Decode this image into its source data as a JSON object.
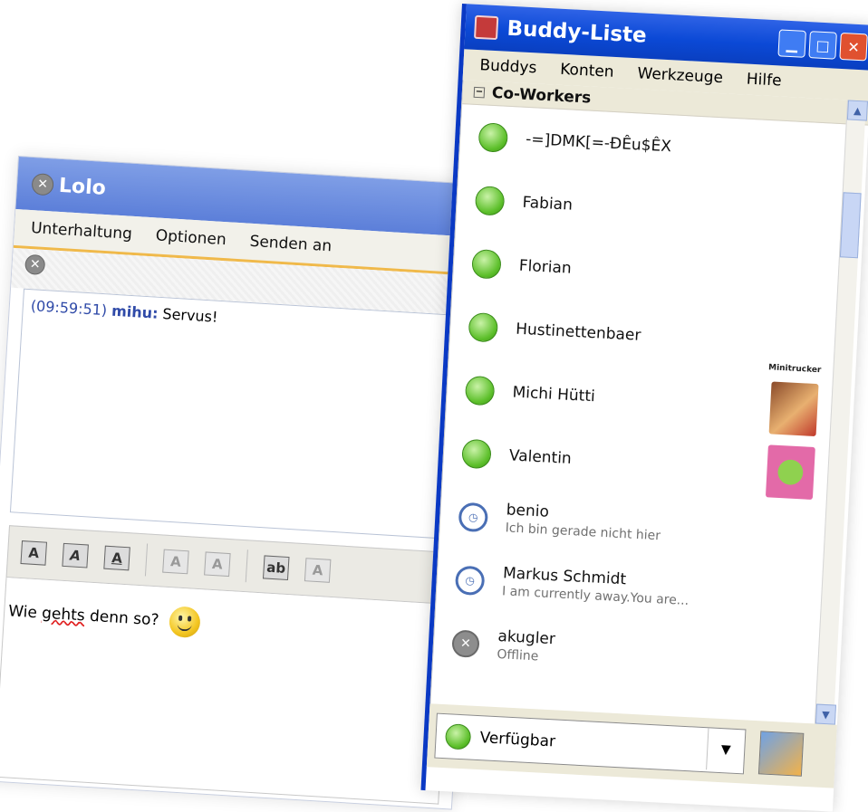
{
  "conversation": {
    "title": "Lolo",
    "menu": [
      "Unterhaltung",
      "Optionen",
      "Senden an"
    ],
    "partial_name": "Lo",
    "log": {
      "time": "(09:59:51)",
      "nick": "mihu:",
      "text": "Servus!"
    },
    "input": {
      "word1": "Wie",
      "misspelled": "gehts",
      "rest": "denn so?"
    },
    "toolbar": [
      "A",
      "A",
      "A",
      "A",
      "A",
      "ab",
      "A"
    ]
  },
  "buddy_list": {
    "title": "Buddy-Liste",
    "menu": [
      "Buddys",
      "Konten",
      "Werkzeuge",
      "Hilfe"
    ],
    "group": "Co-Workers",
    "online": [
      "-=]DMK[=-ÐÊu$ÊX",
      "Fabian",
      "Florian",
      "Hustinettenbaer",
      "Michi Hütti",
      "Valentin"
    ],
    "away": [
      {
        "name": "benio",
        "status": "Ich bin gerade nicht hier"
      },
      {
        "name": "Markus Schmidt",
        "status": "I am currently away.You are..."
      }
    ],
    "offline": [
      {
        "name": "akugler",
        "status": "Offline"
      }
    ],
    "avatar_label": "Minitrucker",
    "status": "Verfügbar",
    "icons": [
      "app-icon",
      "minimize-icon",
      "maximize-icon",
      "close-icon",
      "available-icon",
      "away-icon",
      "offline-icon"
    ]
  }
}
